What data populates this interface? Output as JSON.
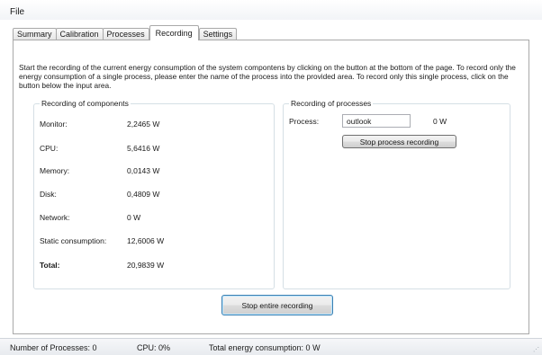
{
  "menu": {
    "file": "File"
  },
  "tabs": [
    {
      "label": "Summary"
    },
    {
      "label": "Calibration"
    },
    {
      "label": "Processes"
    },
    {
      "label": "Recording"
    },
    {
      "label": "Settings"
    }
  ],
  "intro": "Start the recording of the current energy consumption of the system compontens by clicking on the button at the bottom of the page. To record only the energy consumption of a single process, please enter the name of the process into the provided area. To record only this single process, click on the button below the input area.",
  "components": {
    "title": "Recording of components",
    "rows": [
      {
        "label": "Monitor:",
        "value": "2,2465 W"
      },
      {
        "label": "CPU:",
        "value": "5,6416 W"
      },
      {
        "label": "Memory:",
        "value": "0,0143 W"
      },
      {
        "label": "Disk:",
        "value": "0,4809 W"
      },
      {
        "label": "Network:",
        "value": "0 W"
      },
      {
        "label": "Static consumption:",
        "value": "12,6006 W"
      },
      {
        "label": "Total:",
        "value": "20,9839 W"
      }
    ]
  },
  "processes": {
    "title": "Recording of processes",
    "process_label": "Process:",
    "process_value": "outlook",
    "process_watts": "0 W",
    "stop_button": "Stop process recording"
  },
  "stop_all_button": "Stop entire recording",
  "status": {
    "processes": "Number of Processes: 0",
    "cpu": "CPU: 0%",
    "total": "Total energy consumption: 0 W"
  }
}
